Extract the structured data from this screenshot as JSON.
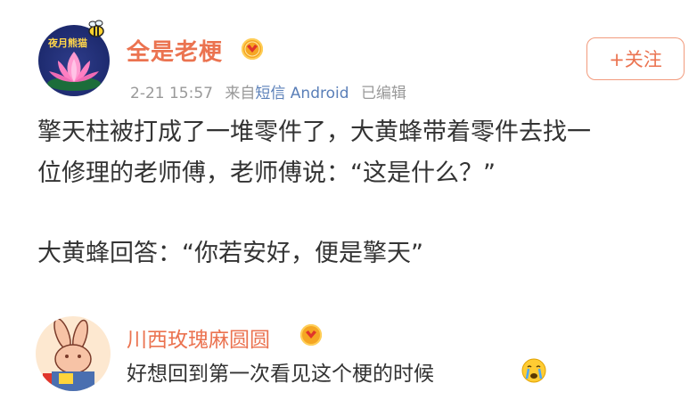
{
  "post": {
    "author": "全是老梗",
    "avatar_text": "夜月熊猫",
    "time": "2-21 15:57",
    "source_prefix": "来自",
    "source": "短信 Android",
    "edited": "已编辑",
    "follow_label": "+关注",
    "paragraphs": [
      "擎天柱被打成了一堆零件了，大黄蜂带着零件去找一",
      "位修理的老师傅，老师傅说：“这是什么？”",
      "大黄蜂回答：“你若安好，便是擎天”"
    ]
  },
  "comment": {
    "author": "川西玫瑰麻圆圆",
    "text": "好想回到第一次看见这个梗的时候",
    "emoji": "crying-face-icon"
  },
  "colors": {
    "accent": "#eb7350",
    "link": "#5a7fb8",
    "meta": "#999999",
    "badge": "#f5a623"
  }
}
